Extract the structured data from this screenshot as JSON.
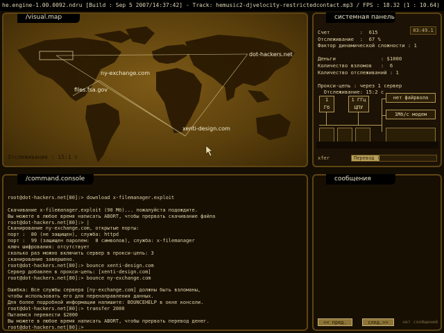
{
  "titlebar": "he.engine-1.00.0092.ndru [Build : Sep  5 2007/14:37:42] - Track: hemusic2-djvelocity-restrictedcontact.mp3 / FPS : 18.32 (1 : 10.64)",
  "map": {
    "title": "/visual.map",
    "status": "Отслеживание : 15:1 с",
    "nodes": [
      {
        "label": "dot-hackers.net"
      },
      {
        "label": "ny-exchange.com"
      },
      {
        "label": "files.fsa.gov"
      },
      {
        "label": "xenti-design.com"
      }
    ]
  },
  "system": {
    "title": "системная панель",
    "clock": "03:49.1",
    "lines": [
      "Счет          :  615",
      "Отслеживание  :  67 %",
      "Фактор динамической сложности : 1",
      "",
      "Деньги               : $1000",
      "Количество взломов   :  6",
      "Количество отслеживаний : 1",
      "",
      "Прокси-цепь : через 1 сервер",
      "  Отслеживание: 15:2 с"
    ],
    "hw_ram": "1\nГб",
    "hw_cpu": "1 ГГц\nЦПУ",
    "hw_firewall": "нет файрвола",
    "hw_modem": "1Мб/с модем",
    "xfer_label": "xfer",
    "xfer_text": "Перевод (4)",
    "xfer_progress": 0.33
  },
  "console": {
    "title": "/command.console",
    "lines": [
      "root@dot-hackers.net[80]:> download x-filemanager.exploit",
      "",
      "Скачивание x-filemanager.exploit (90 Мб)... пожалуйста подождите.",
      "Вы можете в любое время написать ABORT, чтобы прервать скачивание файла",
      "root@dot-hackers.net[80]:> |",
      "Сканирование ny-exchange.com, открытые порты:",
      "порт :  80 (не защищен), служба: httpd",
      "порт :  99 (защищен паролем:  8 символов), служба: x-filemanager",
      "ключ шифрования: отсутствует",
      "сколько раз можно включить сервер в прокси-цепь: 3",
      "сканирование завершено.",
      "root@dot-hackers.net[80]:> bounce xenti-design.com",
      "Сервер добавлен в прокси-цепь: [xenti-design.com]",
      "root@dot-hackers.net[80]:> bounce ny-exchange.com",
      "",
      "Ошибка: Все службы сервера [ny-exchange.com] должны быть взломаны,",
      "чтобы использовать его для перенаправления данных.",
      "Для более подробной информации напишите: BOUNCEHELP в окне консоли.",
      "root@dot-hackers.net[80]:> transfer 2000",
      "Пытаемся перевести $2000",
      "Вы можете в любое время написать ABORT, чтобы прервать перевод денег.",
      "root@dot-hackers.net[80]:>"
    ]
  },
  "messages": {
    "title": "сообщения",
    "prev": "<< пред.",
    "next": "след.>>",
    "status": "нет сообщений"
  }
}
